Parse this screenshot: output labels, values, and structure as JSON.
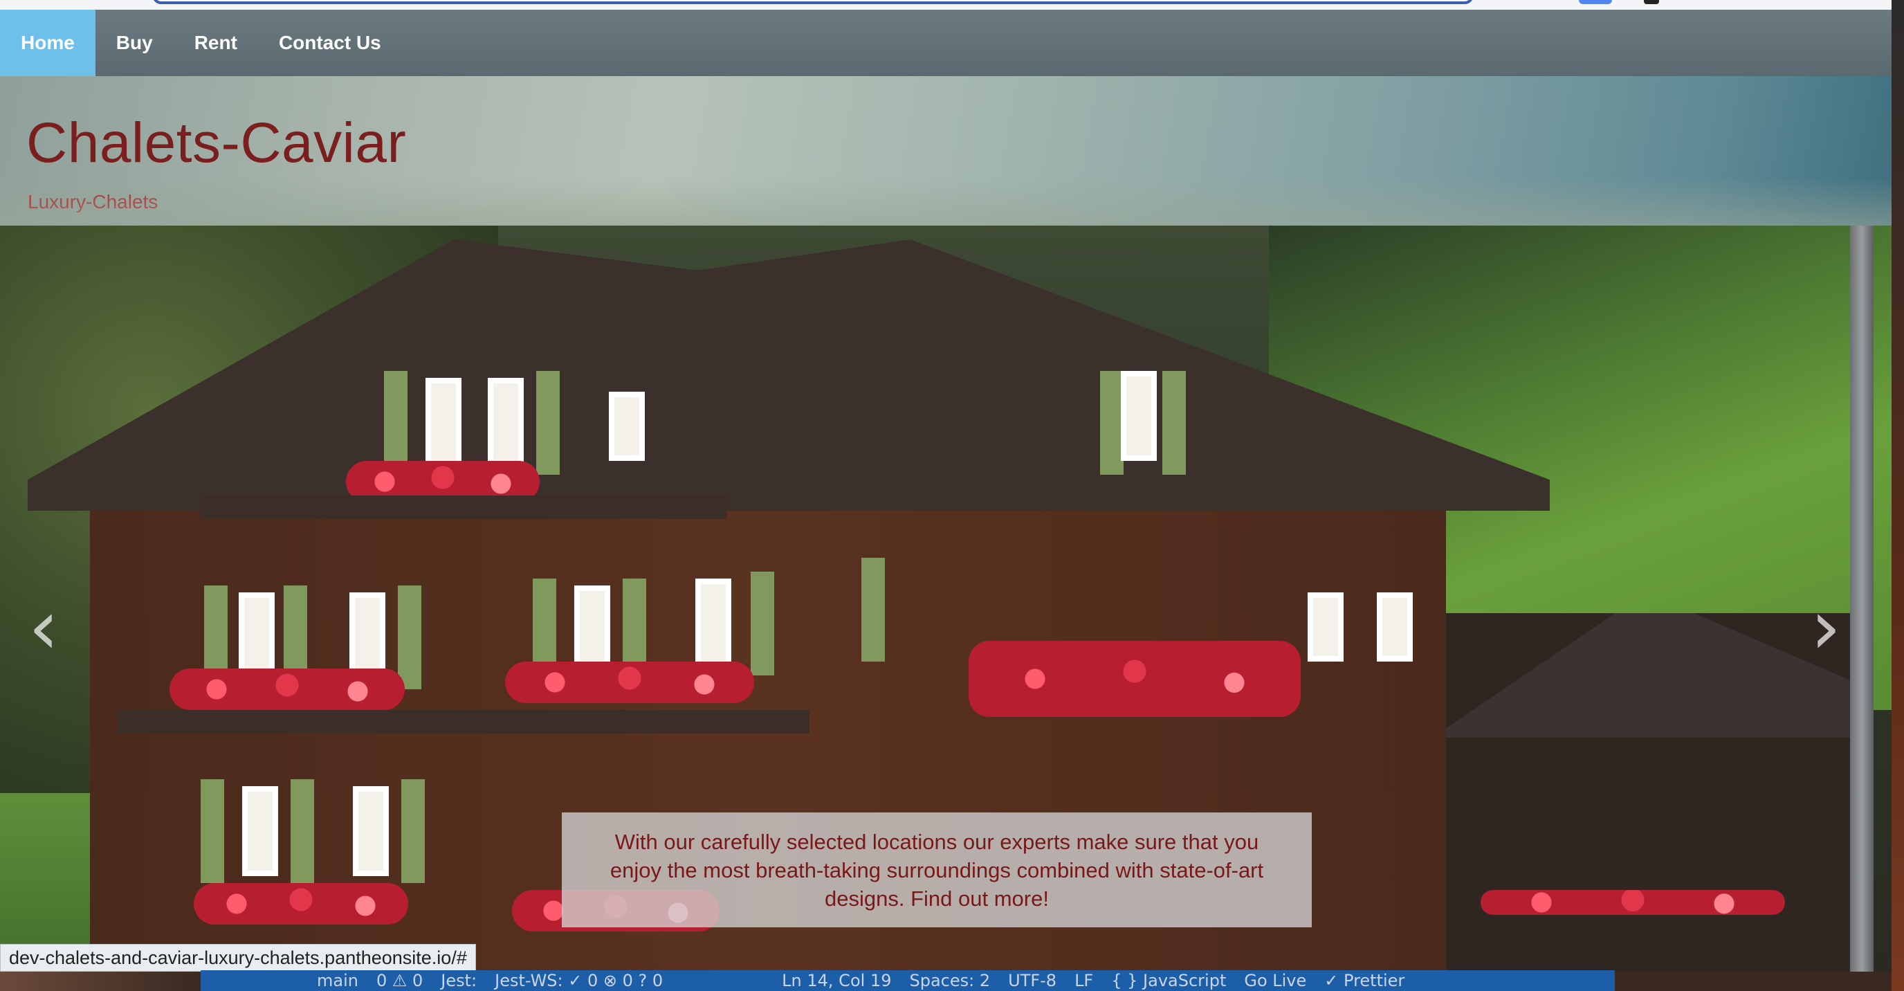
{
  "nav": {
    "items": [
      {
        "label": "Home",
        "active": true
      },
      {
        "label": "Buy",
        "active": false
      },
      {
        "label": "Rent",
        "active": false
      },
      {
        "label": "Contact Us",
        "active": false
      }
    ]
  },
  "header": {
    "title": "Chalets-Caviar",
    "tagline": "Luxury-Chalets"
  },
  "carousel": {
    "prev_icon": "chevron-left-icon",
    "next_icon": "chevron-right-icon",
    "prev_glyph": "‹",
    "next_glyph": "›",
    "caption": "With our carefully selected locations our experts make sure that you enjoy the most breath-taking surroundings combined with state-of-art designs. Find out more!"
  },
  "status_url": "dev-chalets-and-caviar-luxury-chalets.pantheonsite.io/#",
  "editor_status": {
    "branch": "main",
    "problems": "0 ⚠ 0",
    "jest": "Jest:",
    "jest_ws": "Jest-WS: ✓ 0 ⊗ 0 ? 0",
    "position": "Ln 14, Col 19",
    "spaces": "Spaces: 2",
    "encoding": "UTF-8",
    "eol": "LF",
    "language": "{ } JavaScript",
    "golive": "Go Live",
    "prettier": "✓ Prettier"
  },
  "colors": {
    "nav_active": "#6cc0ea",
    "title": "#7a1e1e",
    "tagline": "#b02a2a",
    "caption_text": "#7a1818",
    "editor_bar": "#1d5ea8"
  }
}
